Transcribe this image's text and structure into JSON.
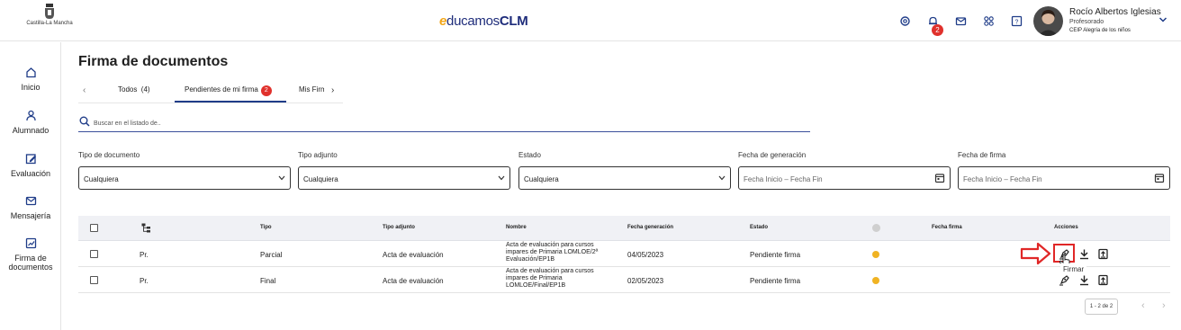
{
  "header": {
    "logo_text": "Castilla-La Mancha",
    "brand_prefix": "e",
    "brand_middle": "ducamos",
    "brand_suffix": "CLM",
    "notification_count": "2",
    "icons": [
      "settings-icon",
      "bell-icon",
      "mail-icon",
      "apps-grid-icon",
      "help-icon"
    ],
    "user_name": "Rocío Albertos Iglesias",
    "user_role": "Profesorado",
    "user_school": "CEIP Alegría de los niños"
  },
  "sidebar": {
    "items": [
      {
        "label": "Inicio",
        "icon": "home-icon"
      },
      {
        "label": "Alumnado",
        "icon": "person-icon"
      },
      {
        "label": "Evaluación",
        "icon": "edit-square-icon"
      },
      {
        "label": "Mensajería",
        "icon": "mail-icon"
      },
      {
        "label_line1": "Firma de",
        "label_line2": "documentos",
        "icon": "sign-document-icon"
      }
    ]
  },
  "page": {
    "title": "Firma de documentos",
    "tabs": [
      {
        "label": "Todos  (4)"
      },
      {
        "label": "Pendientes de mi firma",
        "badge": "2"
      },
      {
        "label": "Mis Firm"
      }
    ],
    "search_placeholder": "Buscar en el listado de.."
  },
  "filters": [
    {
      "label": "Tipo de documento",
      "value": "Cualquiera"
    },
    {
      "label": "Tipo adjunto",
      "value": "Cualquiera"
    },
    {
      "label": "Estado",
      "value": "Cualquiera"
    },
    {
      "label": "Fecha de generación",
      "placeholder": "Fecha Inicio – Fecha Fin"
    },
    {
      "label": "Fecha de firma",
      "placeholder": "Fecha Inicio – Fecha Fin"
    }
  ],
  "table": {
    "headers": {
      "tipo": "Tipo",
      "tipo_adjunto": "Tipo adjunto",
      "nombre": "Nombre",
      "fecha_generacion": "Fecha generación",
      "estado": "Estado",
      "fecha_firma": "Fecha firma",
      "acciones": "Acciones"
    },
    "rows": [
      {
        "col1": "Pr.",
        "tipo": "Parcial",
        "tipo_adjunto": "Acta de evaluación",
        "nombre_l1": "Acta de evaluación para cursos",
        "nombre_l2": "impares de Primaria LOMLOE/2ª",
        "nombre_l3": "Evaluación/EP1B",
        "fecha_generacion": "04/05/2023",
        "estado": "Pendiente firma",
        "estado_color": "#f0b323"
      },
      {
        "col1": "Pr.",
        "tipo": "Final",
        "tipo_adjunto": "Acta de evaluación",
        "nombre_l1": "Acta de evaluación para cursos",
        "nombre_l2": "impares de Primaria",
        "nombre_l3": "LOMLOE/Final/EP1B",
        "fecha_generacion": "02/05/2023",
        "estado": "Pendiente firma",
        "estado_color": "#f0b323"
      }
    ],
    "tooltip": "Firmar"
  },
  "pagination": {
    "label": "1 - 2 de 2"
  },
  "colors": {
    "accent": "#1f3c88",
    "badge": "#e0312c",
    "pending": "#f0b323",
    "highlight": "#e02727"
  }
}
